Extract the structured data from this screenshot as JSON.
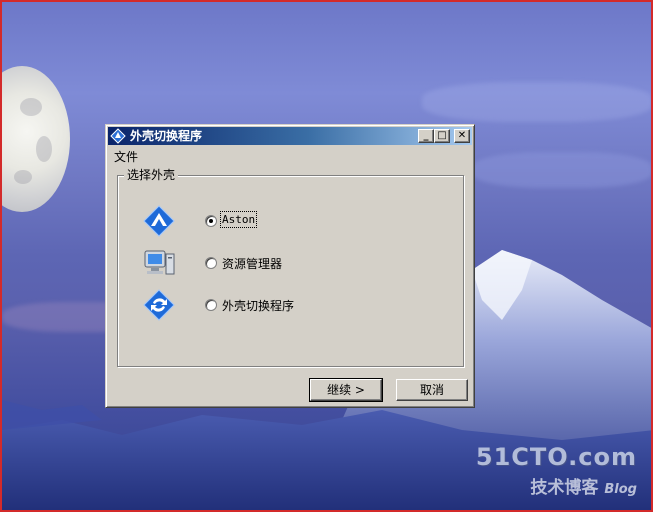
{
  "window": {
    "title": "外壳切换程序",
    "controls": {
      "minimize": "_",
      "maximize": "□",
      "close": "✕"
    }
  },
  "menu": {
    "file": "文件"
  },
  "group": {
    "label": "选择外壳",
    "options": [
      {
        "label": "Aston",
        "icon": "aston-diamond-icon",
        "selected": true
      },
      {
        "label": "资源管理器",
        "icon": "computer-icon",
        "selected": false
      },
      {
        "label": "外壳切换程序",
        "icon": "shell-switcher-icon",
        "selected": false
      }
    ]
  },
  "buttons": {
    "continue": "继续 >",
    "cancel": "取消"
  },
  "watermark": {
    "site": "51CTO.com",
    "line2": "技术博客",
    "blog": "Blog"
  },
  "colors": {
    "titlebar_start": "#0a246a",
    "titlebar_end": "#a6caf0",
    "dialog_bg": "#d4d0c8",
    "desktop_frame": "#d32a2a"
  }
}
